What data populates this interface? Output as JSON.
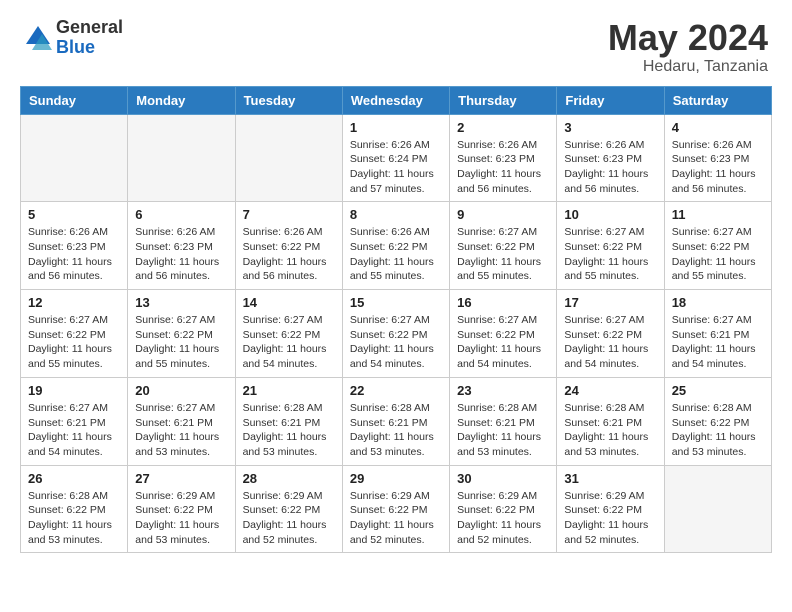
{
  "header": {
    "logo_general": "General",
    "logo_blue": "Blue",
    "month": "May 2024",
    "location": "Hedaru, Tanzania"
  },
  "days_of_week": [
    "Sunday",
    "Monday",
    "Tuesday",
    "Wednesday",
    "Thursday",
    "Friday",
    "Saturday"
  ],
  "weeks": [
    [
      {
        "day": "",
        "info": ""
      },
      {
        "day": "",
        "info": ""
      },
      {
        "day": "",
        "info": ""
      },
      {
        "day": "1",
        "info": "Sunrise: 6:26 AM\nSunset: 6:24 PM\nDaylight: 11 hours\nand 57 minutes."
      },
      {
        "day": "2",
        "info": "Sunrise: 6:26 AM\nSunset: 6:23 PM\nDaylight: 11 hours\nand 56 minutes."
      },
      {
        "day": "3",
        "info": "Sunrise: 6:26 AM\nSunset: 6:23 PM\nDaylight: 11 hours\nand 56 minutes."
      },
      {
        "day": "4",
        "info": "Sunrise: 6:26 AM\nSunset: 6:23 PM\nDaylight: 11 hours\nand 56 minutes."
      }
    ],
    [
      {
        "day": "5",
        "info": "Sunrise: 6:26 AM\nSunset: 6:23 PM\nDaylight: 11 hours\nand 56 minutes."
      },
      {
        "day": "6",
        "info": "Sunrise: 6:26 AM\nSunset: 6:23 PM\nDaylight: 11 hours\nand 56 minutes."
      },
      {
        "day": "7",
        "info": "Sunrise: 6:26 AM\nSunset: 6:22 PM\nDaylight: 11 hours\nand 56 minutes."
      },
      {
        "day": "8",
        "info": "Sunrise: 6:26 AM\nSunset: 6:22 PM\nDaylight: 11 hours\nand 55 minutes."
      },
      {
        "day": "9",
        "info": "Sunrise: 6:27 AM\nSunset: 6:22 PM\nDaylight: 11 hours\nand 55 minutes."
      },
      {
        "day": "10",
        "info": "Sunrise: 6:27 AM\nSunset: 6:22 PM\nDaylight: 11 hours\nand 55 minutes."
      },
      {
        "day": "11",
        "info": "Sunrise: 6:27 AM\nSunset: 6:22 PM\nDaylight: 11 hours\nand 55 minutes."
      }
    ],
    [
      {
        "day": "12",
        "info": "Sunrise: 6:27 AM\nSunset: 6:22 PM\nDaylight: 11 hours\nand 55 minutes."
      },
      {
        "day": "13",
        "info": "Sunrise: 6:27 AM\nSunset: 6:22 PM\nDaylight: 11 hours\nand 55 minutes."
      },
      {
        "day": "14",
        "info": "Sunrise: 6:27 AM\nSunset: 6:22 PM\nDaylight: 11 hours\nand 54 minutes."
      },
      {
        "day": "15",
        "info": "Sunrise: 6:27 AM\nSunset: 6:22 PM\nDaylight: 11 hours\nand 54 minutes."
      },
      {
        "day": "16",
        "info": "Sunrise: 6:27 AM\nSunset: 6:22 PM\nDaylight: 11 hours\nand 54 minutes."
      },
      {
        "day": "17",
        "info": "Sunrise: 6:27 AM\nSunset: 6:22 PM\nDaylight: 11 hours\nand 54 minutes."
      },
      {
        "day": "18",
        "info": "Sunrise: 6:27 AM\nSunset: 6:21 PM\nDaylight: 11 hours\nand 54 minutes."
      }
    ],
    [
      {
        "day": "19",
        "info": "Sunrise: 6:27 AM\nSunset: 6:21 PM\nDaylight: 11 hours\nand 54 minutes."
      },
      {
        "day": "20",
        "info": "Sunrise: 6:27 AM\nSunset: 6:21 PM\nDaylight: 11 hours\nand 53 minutes."
      },
      {
        "day": "21",
        "info": "Sunrise: 6:28 AM\nSunset: 6:21 PM\nDaylight: 11 hours\nand 53 minutes."
      },
      {
        "day": "22",
        "info": "Sunrise: 6:28 AM\nSunset: 6:21 PM\nDaylight: 11 hours\nand 53 minutes."
      },
      {
        "day": "23",
        "info": "Sunrise: 6:28 AM\nSunset: 6:21 PM\nDaylight: 11 hours\nand 53 minutes."
      },
      {
        "day": "24",
        "info": "Sunrise: 6:28 AM\nSunset: 6:21 PM\nDaylight: 11 hours\nand 53 minutes."
      },
      {
        "day": "25",
        "info": "Sunrise: 6:28 AM\nSunset: 6:22 PM\nDaylight: 11 hours\nand 53 minutes."
      }
    ],
    [
      {
        "day": "26",
        "info": "Sunrise: 6:28 AM\nSunset: 6:22 PM\nDaylight: 11 hours\nand 53 minutes."
      },
      {
        "day": "27",
        "info": "Sunrise: 6:29 AM\nSunset: 6:22 PM\nDaylight: 11 hours\nand 53 minutes."
      },
      {
        "day": "28",
        "info": "Sunrise: 6:29 AM\nSunset: 6:22 PM\nDaylight: 11 hours\nand 52 minutes."
      },
      {
        "day": "29",
        "info": "Sunrise: 6:29 AM\nSunset: 6:22 PM\nDaylight: 11 hours\nand 52 minutes."
      },
      {
        "day": "30",
        "info": "Sunrise: 6:29 AM\nSunset: 6:22 PM\nDaylight: 11 hours\nand 52 minutes."
      },
      {
        "day": "31",
        "info": "Sunrise: 6:29 AM\nSunset: 6:22 PM\nDaylight: 11 hours\nand 52 minutes."
      },
      {
        "day": "",
        "info": ""
      }
    ]
  ]
}
